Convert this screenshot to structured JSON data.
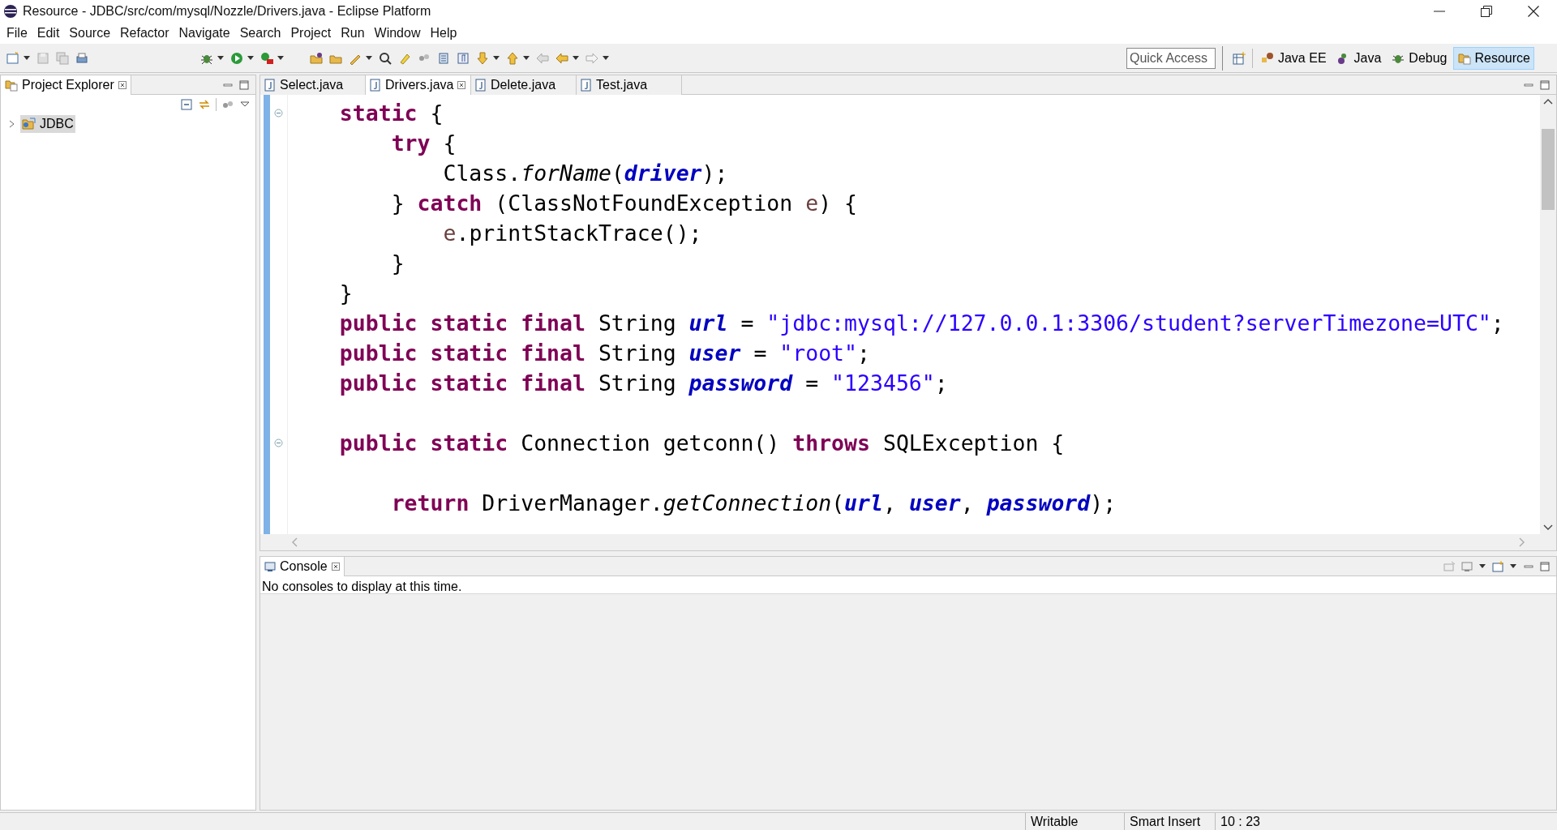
{
  "window": {
    "title": "Resource - JDBC/src/com/mysql/Nozzle/Drivers.java - Eclipse Platform"
  },
  "menu": [
    "File",
    "Edit",
    "Source",
    "Refactor",
    "Navigate",
    "Search",
    "Project",
    "Run",
    "Window",
    "Help"
  ],
  "quick_access": {
    "placeholder": "Quick Access"
  },
  "perspectives": [
    {
      "label": "Java EE",
      "selected": false
    },
    {
      "label": "Java",
      "selected": false
    },
    {
      "label": "Debug",
      "selected": false
    },
    {
      "label": "Resource",
      "selected": true
    }
  ],
  "project_explorer": {
    "title": "Project Explorer",
    "tree": [
      {
        "label": "JDBC",
        "expanded": false,
        "selected": true
      }
    ]
  },
  "editor": {
    "tabs": [
      {
        "label": "Select.java",
        "selected": false
      },
      {
        "label": "Drivers.java",
        "selected": true
      },
      {
        "label": "Delete.java",
        "selected": false
      },
      {
        "label": "Test.java",
        "selected": false
      }
    ],
    "lines": [
      {
        "foldable": true,
        "tokens": [
          {
            "kind": "keyword",
            "text": "    static"
          },
          {
            "kind": "plain",
            "text": " {"
          }
        ]
      },
      {
        "tokens": [
          {
            "kind": "keyword",
            "text": "        try"
          },
          {
            "kind": "plain",
            "text": " {"
          }
        ]
      },
      {
        "tokens": [
          {
            "kind": "plain",
            "text": "            Class."
          },
          {
            "kind": "static_method",
            "text": "forName"
          },
          {
            "kind": "plain",
            "text": "("
          },
          {
            "kind": "field",
            "text": "driver"
          },
          {
            "kind": "plain",
            "text": ");"
          }
        ]
      },
      {
        "tokens": [
          {
            "kind": "plain",
            "text": "        } "
          },
          {
            "kind": "keyword",
            "text": "catch"
          },
          {
            "kind": "plain",
            "text": " (ClassNotFoundException "
          },
          {
            "kind": "local",
            "text": "e"
          },
          {
            "kind": "plain",
            "text": ") {"
          }
        ]
      },
      {
        "tokens": [
          {
            "kind": "local",
            "text": "            e"
          },
          {
            "kind": "plain",
            "text": ".printStackTrace();"
          }
        ]
      },
      {
        "tokens": [
          {
            "kind": "plain",
            "text": "        }"
          }
        ]
      },
      {
        "tokens": [
          {
            "kind": "plain",
            "text": "    }"
          }
        ]
      },
      {
        "tokens": [
          {
            "kind": "keyword",
            "text": "    public static final"
          },
          {
            "kind": "plain",
            "text": " String "
          },
          {
            "kind": "field",
            "text": "url"
          },
          {
            "kind": "plain",
            "text": " = "
          },
          {
            "kind": "string",
            "text": "\"jdbc:mysql://127.0.0.1:3306/student?serverTimezone=UTC\""
          },
          {
            "kind": "plain",
            "text": ";"
          }
        ]
      },
      {
        "tokens": [
          {
            "kind": "keyword",
            "text": "    public static final"
          },
          {
            "kind": "plain",
            "text": " String "
          },
          {
            "kind": "field",
            "text": "user"
          },
          {
            "kind": "plain",
            "text": " = "
          },
          {
            "kind": "string",
            "text": "\"root\""
          },
          {
            "kind": "plain",
            "text": ";"
          }
        ]
      },
      {
        "tokens": [
          {
            "kind": "keyword",
            "text": "    public static final"
          },
          {
            "kind": "plain",
            "text": " String "
          },
          {
            "kind": "field",
            "text": "password"
          },
          {
            "kind": "plain",
            "text": " = "
          },
          {
            "kind": "string",
            "text": "\"123456\""
          },
          {
            "kind": "plain",
            "text": ";"
          }
        ]
      },
      {
        "blank_before": true,
        "foldable": true,
        "tokens": [
          {
            "kind": "keyword",
            "text": "    public static"
          },
          {
            "kind": "plain",
            "text": " Connection getconn() "
          },
          {
            "kind": "keyword",
            "text": "throws"
          },
          {
            "kind": "plain",
            "text": " SQLException {"
          }
        ]
      },
      {
        "blank_before": true,
        "tokens": [
          {
            "kind": "keyword",
            "text": "        return"
          },
          {
            "kind": "plain",
            "text": " DriverManager."
          },
          {
            "kind": "static_method",
            "text": "getConnection"
          },
          {
            "kind": "plain",
            "text": "("
          },
          {
            "kind": "field",
            "text": "url"
          },
          {
            "kind": "plain",
            "text": ", "
          },
          {
            "kind": "field",
            "text": "user"
          },
          {
            "kind": "plain",
            "text": ", "
          },
          {
            "kind": "field",
            "text": "password"
          },
          {
            "kind": "plain",
            "text": ");"
          }
        ]
      }
    ]
  },
  "console": {
    "title": "Console",
    "message": "No consoles to display at this time."
  },
  "status_bar": [
    "Writable",
    "Smart Insert",
    "10 : 23"
  ]
}
